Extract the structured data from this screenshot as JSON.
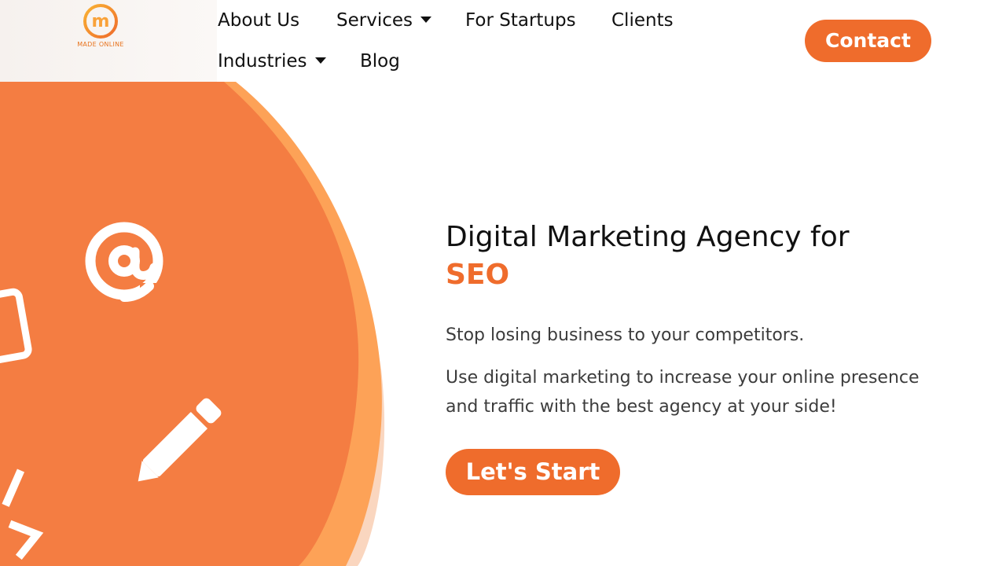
{
  "brand": {
    "logo_text": "MADE ONLINE",
    "logo_letter": "m",
    "accent_color": "#ef6c2c",
    "accent_light": "#f89a4e"
  },
  "nav": {
    "about": "About Us",
    "services": "Services",
    "startups": "For Startups",
    "clients": "Clients",
    "industries": "Industries",
    "blog": "Blog",
    "contact": "Contact"
  },
  "hero": {
    "title": "Digital Marketing Agency for",
    "highlight": "SEO",
    "lead": "Stop losing business to your competitors.",
    "body": "Use digital marketing to increase your online presence and traffic with the best agency at your side!",
    "cta": "Let's Start",
    "icons": [
      "at-sign-icon",
      "pencil-icon",
      "code-icon",
      "tablet-icon"
    ]
  }
}
